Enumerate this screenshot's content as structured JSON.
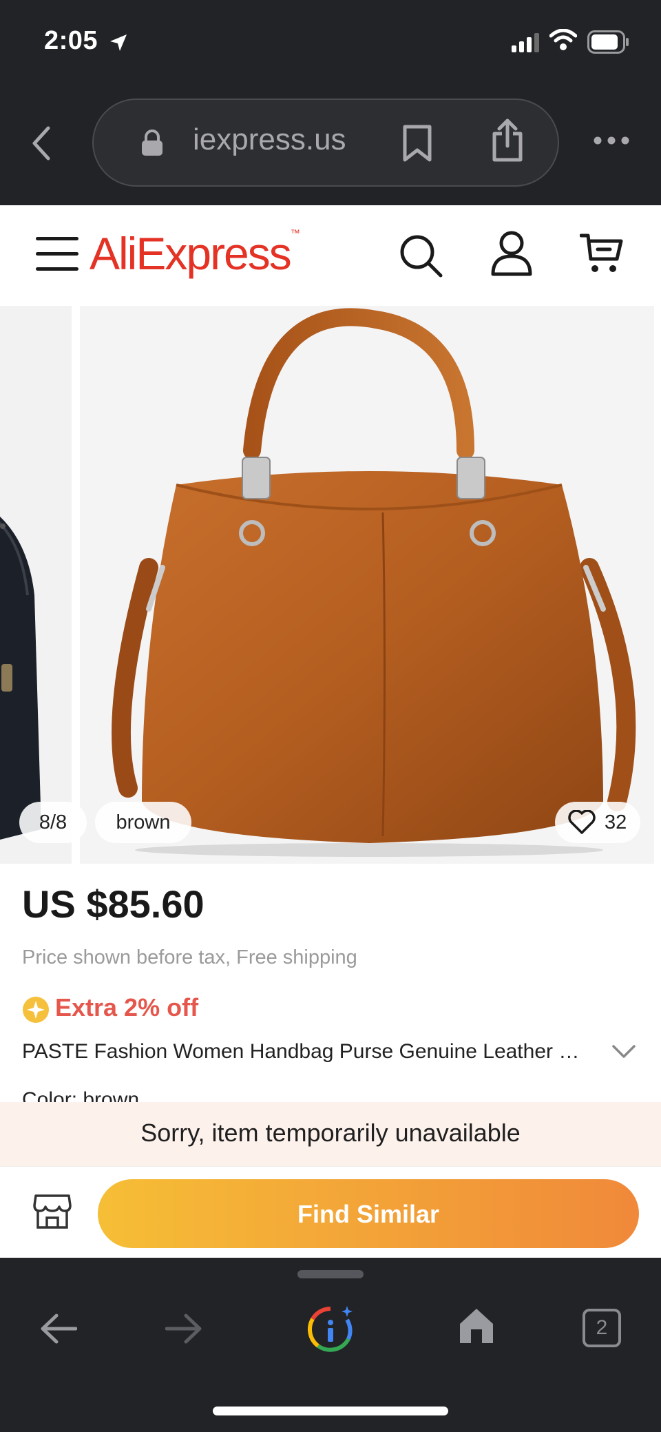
{
  "status_bar": {
    "time": "2:05"
  },
  "browser": {
    "url": "iexpress.us",
    "tabs_count": "2"
  },
  "site": {
    "logo": "AliExpress",
    "logo_tm": "™"
  },
  "gallery": {
    "image_count": "8/8",
    "color": "brown",
    "likes": "32"
  },
  "product": {
    "price": "US $85.60",
    "price_note": "Price shown before tax, Free shipping",
    "promo": "Extra 2% off",
    "title": "PASTE Fashion Women Handbag Purse Genuine Leather Large Capacity Tote Shoulder Crossbody Bag",
    "next_row_partial": "Color: brown"
  },
  "banner": {
    "unavailable": "Sorry, item temporarily unavailable"
  },
  "actions": {
    "find_similar": "Find Similar"
  },
  "colors": {
    "brand": "#e43225",
    "promo": "#e5574c",
    "button_start": "#f6be36",
    "button_end": "#f0893a",
    "chrome": "#222326"
  }
}
